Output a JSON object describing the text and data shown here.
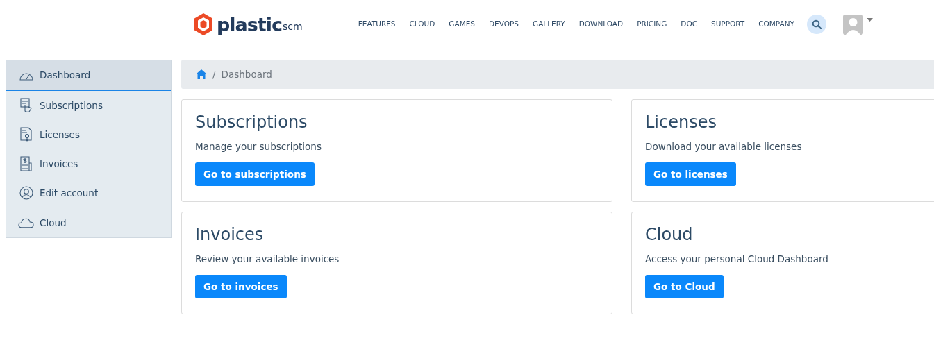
{
  "logo": {
    "name": "plastic",
    "suffix": "scm"
  },
  "nav": {
    "links": [
      "FEATURES",
      "CLOUD",
      "GAMES",
      "DEVOPS",
      "GALLERY",
      "DOWNLOAD",
      "PRICING",
      "DOC",
      "SUPPORT",
      "COMPANY"
    ]
  },
  "sidebar": {
    "groups": [
      [
        {
          "label": "Dashboard",
          "selected": true
        },
        {
          "label": "Subscriptions",
          "selected": false
        },
        {
          "label": "Licenses",
          "selected": false
        },
        {
          "label": "Invoices",
          "selected": false
        },
        {
          "label": "Edit account",
          "selected": false
        }
      ],
      [
        {
          "label": "Cloud",
          "selected": false
        }
      ]
    ]
  },
  "breadcrumb": {
    "separator": "/",
    "items": [
      "Dashboard"
    ]
  },
  "cards": [
    {
      "title": "Subscriptions",
      "text": "Manage your subscriptions",
      "button": "Go to subscriptions"
    },
    {
      "title": "Licenses",
      "text": "Download your available licenses",
      "button": "Go to licenses"
    },
    {
      "title": "Invoices",
      "text": "Review your available invoices",
      "button": "Go to invoices"
    },
    {
      "title": "Cloud",
      "text": "Access your personal Cloud Dashboard",
      "button": "Go to Cloud"
    }
  ]
}
